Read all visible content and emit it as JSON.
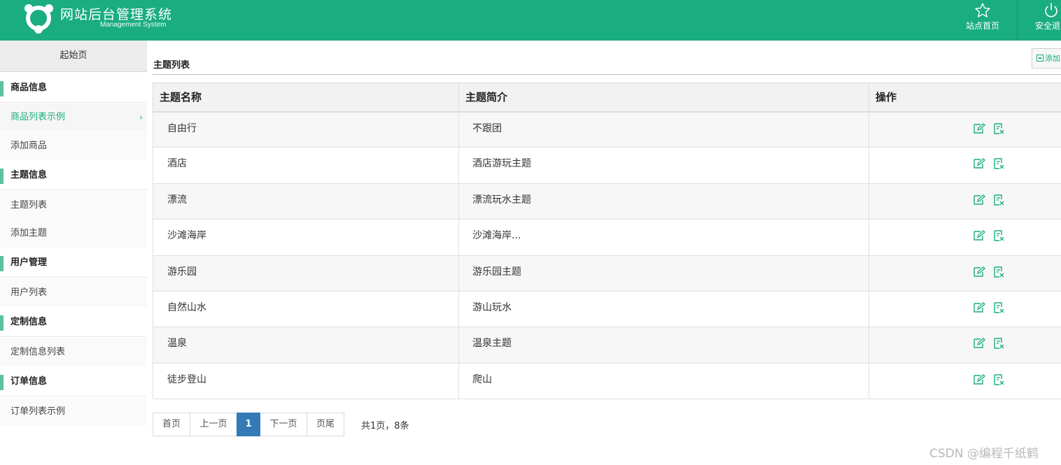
{
  "header": {
    "title": "网站后台管理系统",
    "subtitle": "Management System",
    "home_label": "站点首页",
    "logout_label": "安全退出",
    "accent": "#1aad7f"
  },
  "sidebar": {
    "start_page": "起始页",
    "groups": [
      {
        "label": "商品信息",
        "items": [
          {
            "label": "商品列表示例",
            "active": true
          },
          {
            "label": "添加商品"
          }
        ]
      },
      {
        "label": "主题信息",
        "items": [
          {
            "label": "主题列表"
          },
          {
            "label": "添加主题"
          }
        ]
      },
      {
        "label": "用户管理",
        "items": [
          {
            "label": "用户列表"
          }
        ]
      },
      {
        "label": "定制信息",
        "items": [
          {
            "label": "定制信息列表"
          }
        ]
      },
      {
        "label": "订单信息",
        "items": [
          {
            "label": "订单列表示例"
          }
        ]
      }
    ]
  },
  "main": {
    "title": "主题列表",
    "add_button_label": "添加",
    "table": {
      "columns": [
        "主题名称",
        "主题简介",
        "操作"
      ],
      "rows": [
        [
          "自由行",
          "不跟团"
        ],
        [
          "酒店",
          "酒店游玩主题"
        ],
        [
          "漂流",
          "漂流玩水主题"
        ],
        [
          "沙滩海岸",
          "沙滩海岸..."
        ],
        [
          "游乐园",
          "游乐园主题"
        ],
        [
          "自然山水",
          "游山玩水"
        ],
        [
          "温泉",
          "温泉主题"
        ],
        [
          "徒步登山",
          "爬山"
        ]
      ],
      "row_actions": [
        "edit-icon",
        "delete-icon"
      ]
    },
    "pager": {
      "first": "首页",
      "prev": "上一页",
      "current": "1",
      "next": "下一页",
      "last": "页尾",
      "total": "共1页，8条"
    }
  },
  "watermark": "CSDN @编程千纸鹤"
}
